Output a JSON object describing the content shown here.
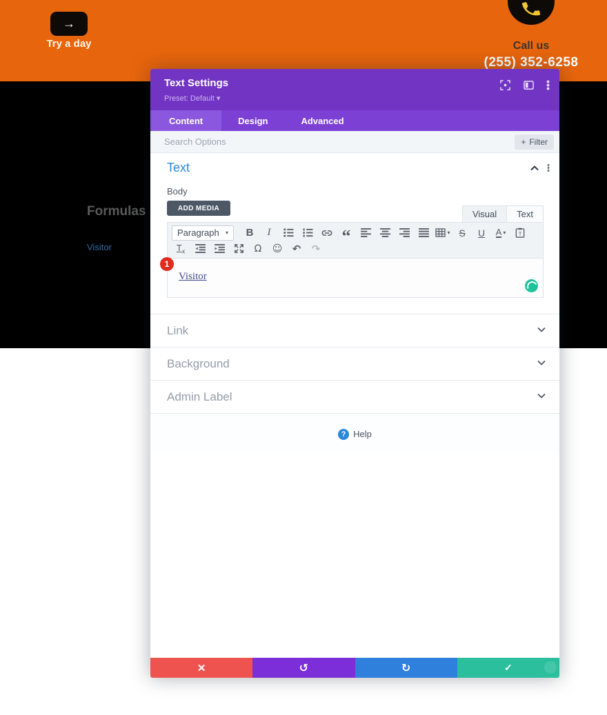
{
  "page": {
    "hero": {
      "arrow": "→",
      "try_label": "Try a day",
      "call_us": "Call us",
      "phone_number": "(255) 352-6258"
    },
    "nav": {
      "heading": "Formulas",
      "visitor_link": "Visitor"
    }
  },
  "modal": {
    "title": "Text Settings",
    "preset": "Preset: Default ▾",
    "tabs": [
      "Content",
      "Design",
      "Advanced"
    ],
    "search": {
      "placeholder": "Search Options",
      "filter_plus": "+",
      "filter_label": "Filter"
    },
    "text_section": {
      "title": "Text",
      "body_label": "Body",
      "add_media_label": "ADD MEDIA",
      "editor_tabs": [
        "Visual",
        "Text"
      ],
      "paragraph_label": "Paragraph",
      "badge_count": "1",
      "content_link_text": "Visitor"
    },
    "collapsed_sections": [
      {
        "label": "Link"
      },
      {
        "label": "Background"
      },
      {
        "label": "Admin Label"
      }
    ],
    "help": {
      "q": "?",
      "label": "Help"
    }
  },
  "icons": {
    "kebab": "⋮",
    "bold": "B",
    "italic": "I",
    "blockquote": "“",
    "strikethrough": "S",
    "underline": "U",
    "textcolor": "A",
    "caret": "▾",
    "clear_format_t": "T",
    "clear_format_x": "x",
    "omega": "Ω",
    "emoticon": "☺",
    "undo": "↶",
    "redo": "↷",
    "action_close": "✕",
    "action_undo": "↺",
    "action_redo": "↻",
    "action_save": "✓"
  },
  "colors": {
    "hero_orange": "#E7650D",
    "band_black": "#000000",
    "header_purple": "#7134C3",
    "tabrow_purple": "#7C40D4",
    "active_tab_purple": "#8B57DE",
    "section_blue": "#2B87DA",
    "action_red": "#EF5350",
    "action_purple": "#7C2FD9",
    "action_blue": "#2F80DC",
    "action_green": "#2BBF9E",
    "badge_red": "#DF2B20",
    "grammarly_green": "#1EC39B",
    "phone_yellow": "#F2C530"
  }
}
